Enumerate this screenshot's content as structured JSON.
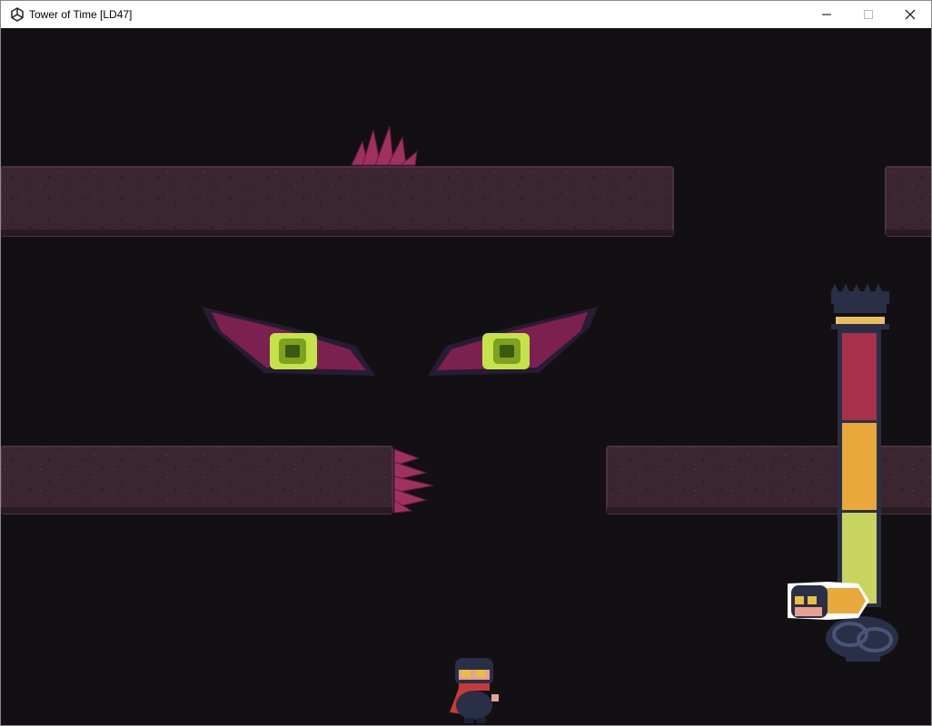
{
  "window": {
    "title": "Tower of Time [LD47]",
    "app_icon": "unity-icon",
    "controls": [
      "minimize-icon",
      "maximize-icon",
      "close-icon"
    ]
  },
  "game": {
    "background_color": "#121013",
    "platform_color": "#3a2530",
    "crystal_color": "#a0305f",
    "eye_color": "#c6e24a",
    "time_meter": {
      "segments": [
        {
          "color": "#a8304a"
        },
        {
          "color": "#e8a83c"
        },
        {
          "color": "#c8d460"
        }
      ],
      "level": 0.05
    }
  }
}
